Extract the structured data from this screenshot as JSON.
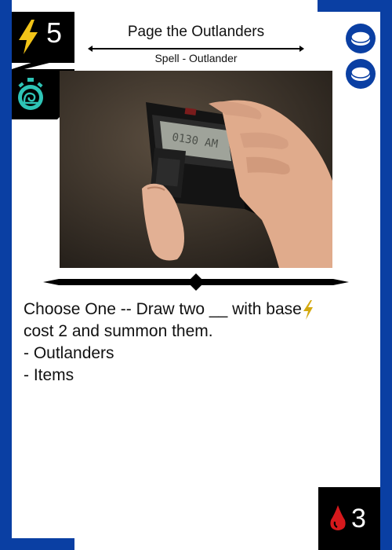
{
  "card": {
    "title": "Page the Outlanders",
    "type_line": "Spell - Outlander",
    "energy_cost": "5",
    "blood_cost": "3",
    "rules": {
      "line1_prefix": "Choose One -- Draw two __ with base",
      "line2": "cost 2 and summon them.",
      "option1": "- Outlanders",
      "option2": "- Items"
    }
  },
  "icons": {
    "cost": "lightning-bolt-icon",
    "speed": "stopwatch-snail-icon",
    "tokens": [
      "token-icon",
      "token-icon"
    ],
    "blood": "blood-drop-icon"
  },
  "colors": {
    "border_blue": "#0a3fa3",
    "cost_bolt": "#f2c418",
    "inline_bolt": "#d4a90f",
    "speed_icon": "#2ec4b6",
    "blood_red": "#d7191c",
    "panel_black": "#000000"
  }
}
